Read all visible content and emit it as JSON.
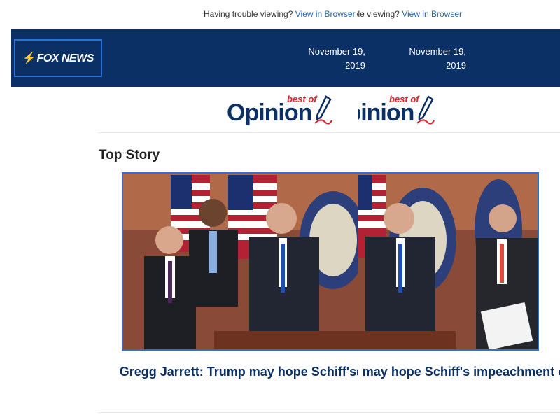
{
  "preheader": {
    "trouble_text": "Having trouble viewing?",
    "view_link": "View in Browser"
  },
  "header": {
    "logo_text": "FOX NEWS",
    "date": "November 19, 2019"
  },
  "banner": {
    "best_of": "best of",
    "opinion": "Opinion"
  },
  "section": {
    "title": "Top Story"
  },
  "story": {
    "headline": "Gregg Jarrett: Trump may hope Schiff's impeachment carnival never stops"
  },
  "colors": {
    "header_bg": "#0a3066",
    "link": "#2a64ad",
    "headline": "#0a3066",
    "accent_red": "#e0202a"
  }
}
